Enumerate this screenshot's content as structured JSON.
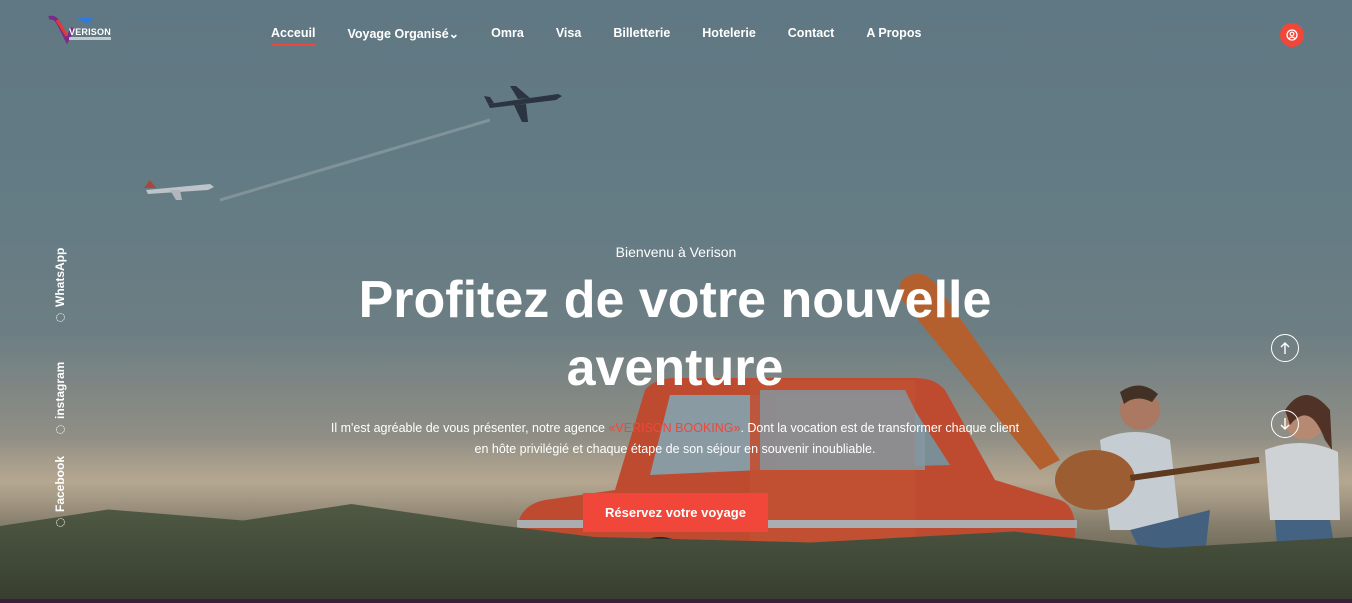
{
  "brand": {
    "logo_text": "VERISON"
  },
  "nav": {
    "items": [
      {
        "label": "Acceuil"
      },
      {
        "label": "Voyage Organisé"
      },
      {
        "label": "Omra"
      },
      {
        "label": "Visa"
      },
      {
        "label": "Billetterie"
      },
      {
        "label": "Hotelerie"
      },
      {
        "label": "Contact"
      },
      {
        "label": "A Propos"
      }
    ]
  },
  "social": {
    "whatsapp": "WhatsApp",
    "instagram": "instagram",
    "facebook": "Facebook"
  },
  "hero": {
    "welcome": "Bienvenu à Verison",
    "headline": "Profitez de votre nouvelle aventure",
    "intro_before": "Il m'est agréable de vous présenter, notre agence ",
    "intro_highlight": "«VERISON BOOKING»",
    "intro_after": ". Dont la vocation est de transformer chaque client en hôte privilégié et chaque étape de son séjour en souvenir inoubliable.",
    "cta_label": "Réservez votre voyage"
  },
  "colors": {
    "accent": "#f0473a",
    "text": "#ffffff"
  },
  "icons": {
    "user": "user-circle-icon",
    "up": "arrow-up-icon",
    "down": "arrow-down-icon",
    "social_bullet": "dotted-circle-icon"
  }
}
